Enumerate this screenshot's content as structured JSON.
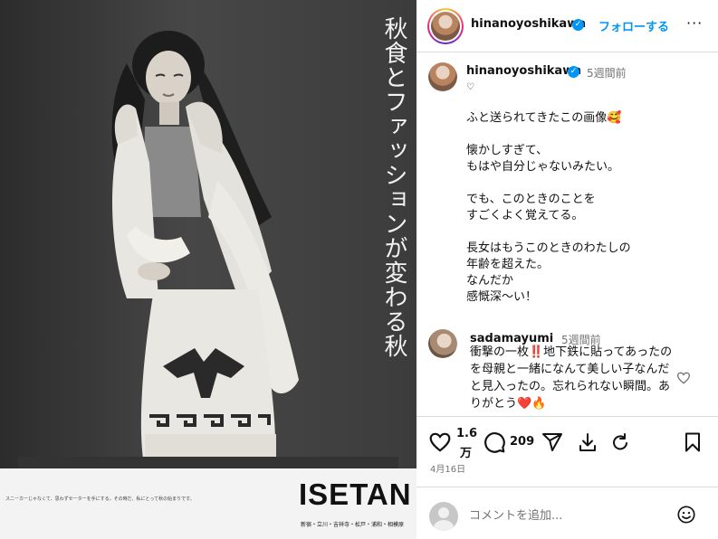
{
  "photo": {
    "headline": "秋食とファッションが変わる秋",
    "logo": "ISETAN",
    "logo_stores": "新宿・立川・吉祥寺・松戸・浦和・相模原",
    "ad_copy": "スニーカーじゃなくて、思わずセーターを手にする。その時だ、私にとって秋の始まりです。",
    "icons": {
      "heart": "heart-icon",
      "comment": "comment-icon",
      "share": "share-icon",
      "save": "save-icon",
      "repost": "repost-icon",
      "bookmark": "bookmark-icon",
      "emoji": "emoji-icon",
      "more": "more-icon",
      "verified": "verified-badge-icon"
    }
  },
  "header": {
    "username": "hinanoyoshikawa",
    "follow_label": "フォローする",
    "more_label": "···"
  },
  "post_caption": {
    "username": "hinanoyoshikawa",
    "time": "5週間前",
    "heart_glyph": "♡",
    "text": "ふと送られてきたこの画像🥰\n\n懐かしすぎて、\nもはや自分じゃないみたい。\n\nでも、このときのことを\nすごくよく覚えてる。\n\n長女はもうこのときのわたしの\n年齢を超えた。\nなんだか\n感慨深〜い！"
  },
  "comment": {
    "username": "sadamayumi",
    "time": "5週間前",
    "text": "衝撃の一枚‼️地下鉄に貼ってあったのを母親と一緒になんて美しい子なんだと見入ったの。忘れられない瞬間。ありがとう❤️🔥"
  },
  "actions": {
    "likes": "1.6",
    "likes_unit": "万",
    "comments": "209",
    "date": "4月16日"
  },
  "composer": {
    "placeholder": "コメントを追加..."
  },
  "colors": {
    "accent": "#0095f6",
    "divider": "#dbdbdb",
    "muted": "#737373"
  }
}
